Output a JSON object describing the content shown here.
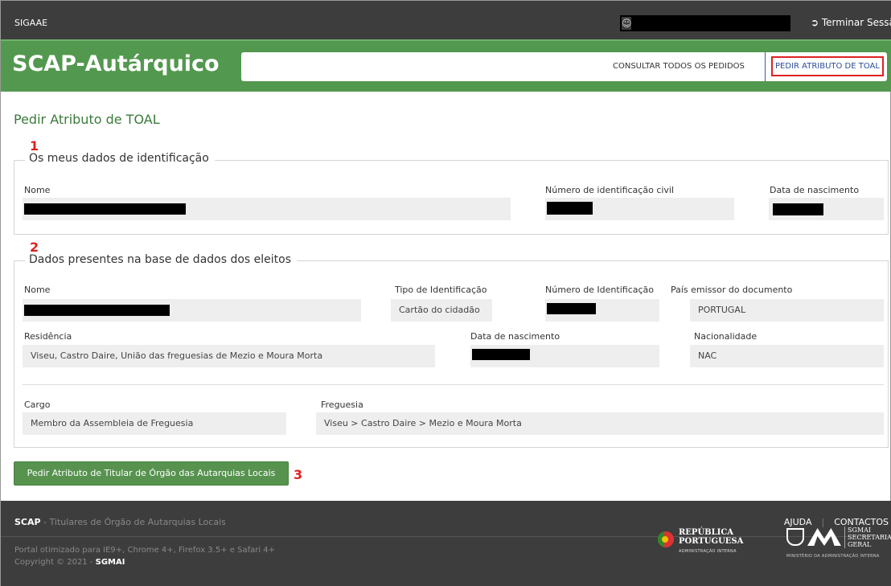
{
  "topbar": {
    "brand": "SIGAAE",
    "user_icon": "user-icon",
    "logout_icon": "logout-icon",
    "logout_label": "Terminar Sessão"
  },
  "header": {
    "app_title": "SCAP-Autárquico",
    "nav": {
      "consult_all": "CONSULTAR TODOS OS PEDIDOS",
      "request_toal": "PEDIR ATRIBUTO DE TOAL"
    }
  },
  "page": {
    "title": "Pedir Atributo de TOAL",
    "markers": [
      "1",
      "2",
      "3"
    ]
  },
  "section1": {
    "legend": "Os meus dados de identificação",
    "labels": {
      "name": "Nome",
      "civil_id": "Número de identificação civil",
      "birth_date": "Data de nascimento"
    }
  },
  "section2": {
    "legend": "Dados presentes na base de dados dos eleitos",
    "labels": {
      "name": "Nome",
      "id_type": "Tipo de Identificação",
      "id_number": "Número de Identificação",
      "issuing_country": "País emissor do documento",
      "residence": "Residência",
      "birth_date": "Data de nascimento",
      "nationality": "Nacionalidade",
      "role": "Cargo",
      "parish": "Freguesia"
    },
    "values": {
      "id_type": "Cartão do cidadão",
      "issuing_country": "PORTUGAL",
      "residence": "Viseu, Castro Daire, União das freguesias de Mezio e Moura Morta",
      "nationality": "NAC",
      "role": "Membro da Assembleia de Freguesia",
      "parish": "Viseu > Castro Daire > Mezio e Moura Morta"
    }
  },
  "action": {
    "submit_label": "Pedir Atributo de Titular de Órgão das Autarquias Locais"
  },
  "footer": {
    "brand": "SCAP",
    "brand_suffix": " - Titulares de Órgão de Autarquias Locais",
    "help": "AJUDA",
    "separator": "|",
    "contacts": "CONTACTOS",
    "browsers": "Portal otimizado para IE9+, Chrome 4+, Firefox 3.5+ e Safari 4+",
    "copyright": "Copyright © 2021 - ",
    "copyright_owner": "SGMAI",
    "logo_rp_line1": "REPÚBLICA",
    "logo_rp_line2": "PORTUGUESA",
    "logo_rp_sub": "ADMINISTRAÇÃO INTERNA",
    "logo_sg_line1": "SGMAI",
    "logo_sg_line2": "SECRETARIA",
    "logo_sg_line3": "GERAL",
    "logo_sg_sub": "MINISTÉRIO DA ADMINISTRAÇÃO INTERNA"
  },
  "colors": {
    "topbar": "#3d3d3d",
    "header_green": "#53984f",
    "title_green": "#3b7a3a",
    "marker_red": "#dd2222",
    "nav_active": "#2b4c9b"
  }
}
